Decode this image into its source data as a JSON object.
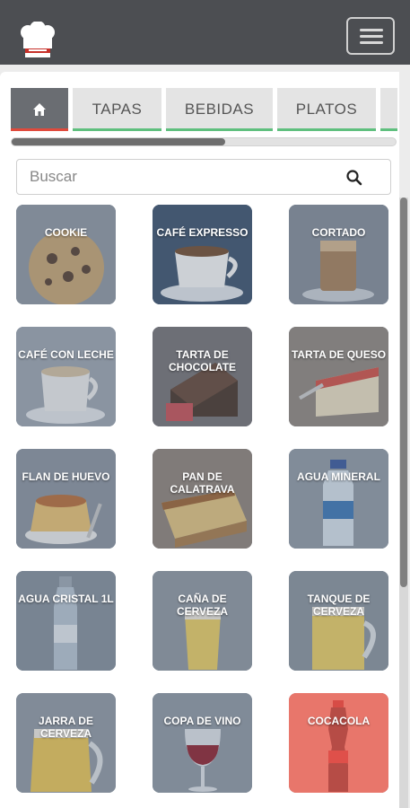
{
  "header": {
    "logo_icon": "chef-hat-icon",
    "menu_icon": "hamburger-icon"
  },
  "tabs": [
    {
      "label": "",
      "icon": "home-icon",
      "active": true
    },
    {
      "label": "TAPAS"
    },
    {
      "label": "BEBIDAS"
    },
    {
      "label": "PLATOS"
    }
  ],
  "search": {
    "placeholder": "Buscar",
    "value": "",
    "icon": "search-icon"
  },
  "products": [
    {
      "label": "COOKIE",
      "image": "cookie"
    },
    {
      "label": "CAFÉ EXPRESSO",
      "image": "espresso"
    },
    {
      "label": "CORTADO",
      "image": "cortado"
    },
    {
      "label": "CAFÉ CON LECHE",
      "image": "latte"
    },
    {
      "label": "TARTA DE\nCHOCOLATE",
      "image": "chocolate-cake"
    },
    {
      "label": "TARTA DE QUESO",
      "image": "cheesecake"
    },
    {
      "label": "FLAN DE HUEVO",
      "image": "flan"
    },
    {
      "label": "PAN DE\nCALATRAVA",
      "image": "bread-pudding"
    },
    {
      "label": "AGUA MINERAL",
      "image": "water-bottle"
    },
    {
      "label": "AGUA CRISTAL 1L",
      "image": "glass-bottle"
    },
    {
      "label": "CAÑA DE\nCERVEZA",
      "image": "beer-glass"
    },
    {
      "label": "TANQUE DE\nCERVEZA",
      "image": "beer-mug"
    },
    {
      "label": "JARRA DE\nCERVEZA",
      "image": "beer-jug"
    },
    {
      "label": "COPA DE VINO",
      "image": "wine-glass"
    },
    {
      "label": "COCACOLA",
      "image": "cola-bottle",
      "highlight": "#e8766c"
    }
  ]
}
